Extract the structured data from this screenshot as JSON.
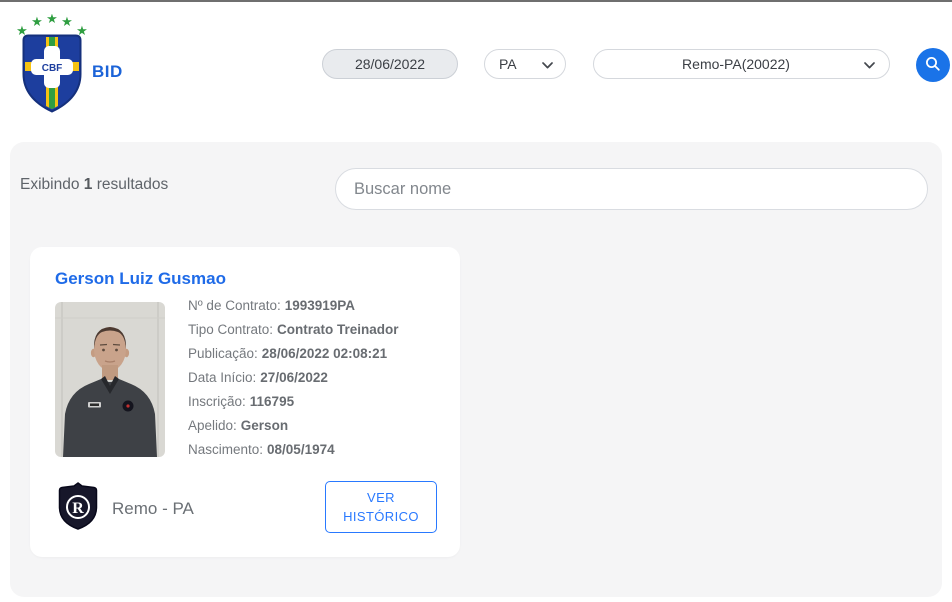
{
  "header": {
    "cbf_monogram": "CBF",
    "app_name": "BID",
    "date_value": "28/06/2022",
    "state_value": "PA",
    "club_value": "Remo-PA(20022)"
  },
  "icons": {
    "search": "magnifier-icon",
    "chevron": "chevron-down-icon",
    "cbf_crest": "cbf-shield-with-stars",
    "club_badge": "remo-shield"
  },
  "results": {
    "count_prefix": "Exibindo",
    "count": "1",
    "count_suffix": "resultados",
    "search_placeholder": "Buscar nome"
  },
  "card": {
    "name": "Gerson Luiz Gusmao",
    "fields": [
      {
        "label": "Nº de Contrato:",
        "value": "1993919PA"
      },
      {
        "label": "Tipo Contrato:",
        "value": "Contrato Treinador"
      },
      {
        "label": "Publicação:",
        "value": "28/06/2022 02:08:21"
      },
      {
        "label": "Data Início:",
        "value": "27/06/2022"
      },
      {
        "label": "Inscrição:",
        "value": "116795"
      },
      {
        "label": "Apelido:",
        "value": "Gerson"
      },
      {
        "label": "Nascimento:",
        "value": "08/05/1974"
      }
    ],
    "club_name": "Remo - PA",
    "club_badge_letter": "R",
    "history_button_label": "VER HISTÓRICO"
  },
  "colors": {
    "accent_blue": "#1a73e8",
    "link_blue": "#1f6be8",
    "button_blue": "#2979ff",
    "panel_bg": "#f5f5f6",
    "text_gray": "#75797e",
    "shield_blue": "#1d3e9e",
    "star_green": "#2f9e41",
    "stripe_yellow": "#f6c313"
  }
}
